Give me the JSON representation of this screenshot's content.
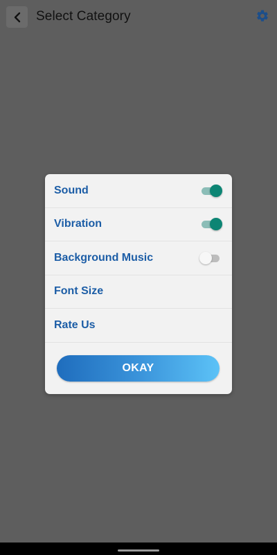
{
  "header": {
    "title": "Select Category",
    "back_icon": "chevron-left-icon",
    "settings_icon": "gear-icon"
  },
  "dialog": {
    "items": [
      {
        "label": "Sound",
        "toggle": true,
        "state": "on"
      },
      {
        "label": "Vibration",
        "toggle": true,
        "state": "on"
      },
      {
        "label": "Background Music",
        "toggle": true,
        "state": "off"
      },
      {
        "label": "Font Size",
        "toggle": false
      },
      {
        "label": "Rate Us",
        "toggle": false
      }
    ],
    "okay_label": "OKAY"
  },
  "colors": {
    "label": "#1c5da6",
    "toggle_on": "#0d8574",
    "gear": "#1c4e8a",
    "button_start": "#1f6dbd",
    "button_end": "#5cc2f7"
  }
}
